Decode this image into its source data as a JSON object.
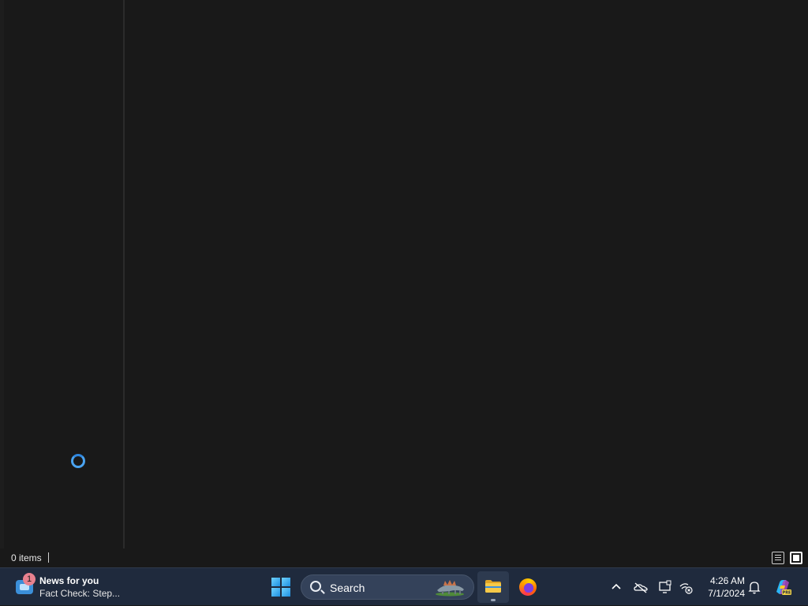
{
  "explorer": {
    "status": {
      "item_count": "0 items",
      "view_details_label": "Details",
      "view_tiles_label": "Large icons"
    },
    "loading": true
  },
  "taskbar": {
    "widget": {
      "badge": "1",
      "title": "News for you",
      "subtitle": "Fact Check: Step..."
    },
    "start_icon": "windows-logo-icon",
    "search": {
      "placeholder": "Search"
    },
    "apps": [
      {
        "name": "File Explorer",
        "icon": "folder-icon",
        "active": true
      },
      {
        "name": "Firefox",
        "icon": "firefox-icon",
        "active": false
      }
    ],
    "tray": {
      "time": "4:26 AM",
      "date": "7/1/2024"
    }
  },
  "colors": {
    "window_bg": "#191919",
    "taskbar_bg": "#1f2a3d",
    "accent": "#2f86de"
  }
}
